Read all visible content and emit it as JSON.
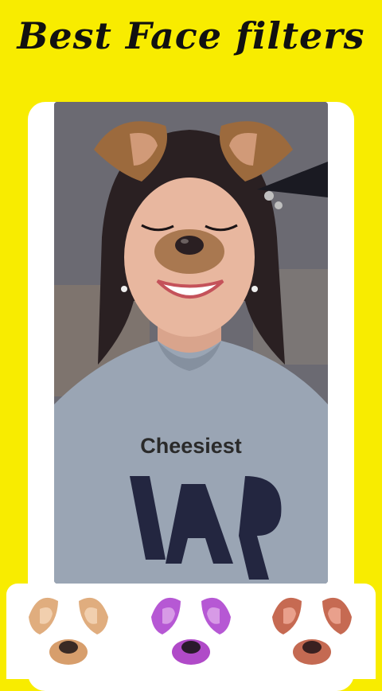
{
  "header": {
    "title": "Best Face filters"
  },
  "preview": {
    "caption": "Cheesiest"
  },
  "filters": [
    {
      "name": "dog-filter-brown",
      "color": "#d9a574"
    },
    {
      "name": "dog-filter-purple",
      "color": "#b45ad2"
    },
    {
      "name": "dog-filter-red",
      "color": "#c0644c"
    }
  ],
  "colors": {
    "background": "#f8ec00",
    "card": "#ffffff",
    "title": "#111111"
  }
}
